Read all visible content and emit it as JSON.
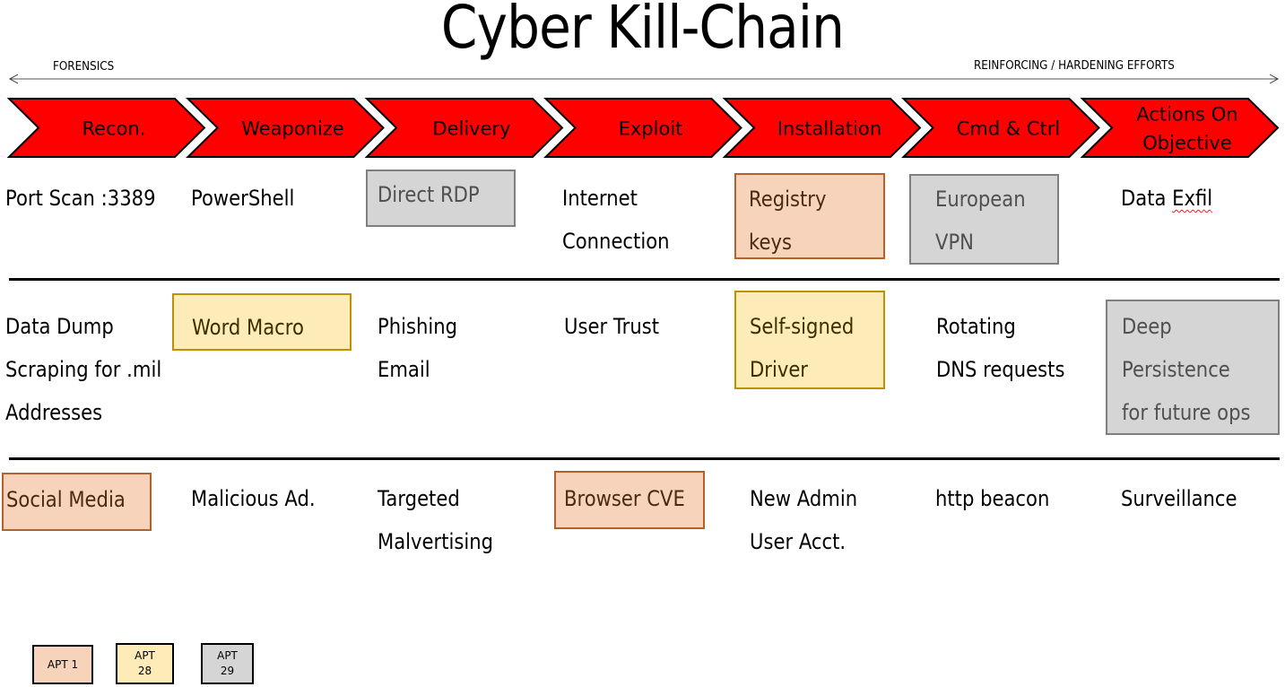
{
  "title": "Cyber Kill-Chain",
  "axis": {
    "left_label": "FORENSICS",
    "right_label": "REINFORCING / HARDENING EFFORTS"
  },
  "colors": {
    "chevron_fill": "#ff0000",
    "apt1_fill": "#f8d3bc",
    "apt1_border": "#b5612a",
    "apt28_fill": "#fdebb8",
    "apt28_border": "#bf9000",
    "apt29_fill": "#d5d5d5",
    "apt29_border": "#7f7f7f"
  },
  "phases": [
    {
      "label": [
        "Recon."
      ]
    },
    {
      "label": [
        "Weaponize"
      ]
    },
    {
      "label": [
        "Delivery"
      ]
    },
    {
      "label": [
        "Exploit"
      ]
    },
    {
      "label": [
        "Installation"
      ]
    },
    {
      "label": [
        "Cmd & Ctrl"
      ]
    },
    {
      "label": [
        "Actions On",
        "Objective"
      ]
    }
  ],
  "rows": [
    {
      "cells": [
        {
          "phase": "Recon.",
          "lines": [
            "Port Scan :3389"
          ],
          "apt": null
        },
        {
          "phase": "Weaponize",
          "lines": [
            "PowerShell"
          ],
          "apt": null
        },
        {
          "phase": "Delivery",
          "lines": [
            "Direct RDP"
          ],
          "apt": "APT 29"
        },
        {
          "phase": "Exploit",
          "lines": [
            "Internet",
            "Connection"
          ],
          "apt": null
        },
        {
          "phase": "Installation",
          "lines": [
            "Registry",
            "keys"
          ],
          "apt": "APT 1"
        },
        {
          "phase": "Cmd & Ctrl",
          "lines": [
            "European",
            "VPN"
          ],
          "apt": "APT 29"
        },
        {
          "phase": "Actions On Objective",
          "lines": [
            "Data Exfil"
          ],
          "apt": null
        }
      ]
    },
    {
      "cells": [
        {
          "phase": "Recon.",
          "lines": [
            "Data Dump",
            "Scraping for .mil",
            "Addresses"
          ],
          "apt": null
        },
        {
          "phase": "Weaponize",
          "lines": [
            "Word Macro"
          ],
          "apt": "APT 28"
        },
        {
          "phase": "Delivery",
          "lines": [
            "Phishing",
            "Email"
          ],
          "apt": null
        },
        {
          "phase": "Exploit",
          "lines": [
            "User Trust"
          ],
          "apt": null
        },
        {
          "phase": "Installation",
          "lines": [
            "Self-signed",
            "Driver"
          ],
          "apt": "APT 28"
        },
        {
          "phase": "Cmd & Ctrl",
          "lines": [
            "Rotating",
            "DNS requests"
          ],
          "apt": null
        },
        {
          "phase": "Actions On Objective",
          "lines": [
            "Deep",
            "Persistence",
            "for future ops"
          ],
          "apt": "APT 29"
        }
      ]
    },
    {
      "cells": [
        {
          "phase": "Recon.",
          "lines": [
            "Social Media"
          ],
          "apt": "APT 1"
        },
        {
          "phase": "Weaponize",
          "lines": [
            "Malicious Ad."
          ],
          "apt": null
        },
        {
          "phase": "Delivery",
          "lines": [
            "Targeted",
            "Malvertising"
          ],
          "apt": null
        },
        {
          "phase": "Exploit",
          "lines": [
            "Browser CVE"
          ],
          "apt": "APT 1"
        },
        {
          "phase": "Installation",
          "lines": [
            "New Admin",
            "User Acct."
          ],
          "apt": null
        },
        {
          "phase": "Cmd & Ctrl",
          "lines": [
            "http beacon"
          ],
          "apt": null
        },
        {
          "phase": "Actions On Objective",
          "lines": [
            "Surveillance"
          ],
          "apt": null
        }
      ]
    }
  ],
  "legend": [
    {
      "label": "APT 1",
      "display": "APT 1"
    },
    {
      "label": "APT 28",
      "display": "APT\n28"
    },
    {
      "label": "APT 29",
      "display": "APT\n29"
    }
  ]
}
